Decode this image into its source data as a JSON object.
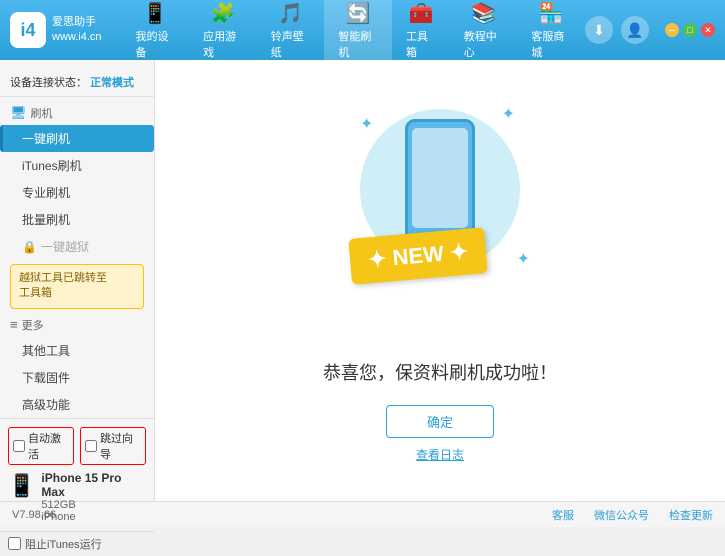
{
  "app": {
    "logo_num": "i4",
    "logo_line1": "爱思助手",
    "logo_line2": "www.i4.cn"
  },
  "nav": {
    "items": [
      {
        "label": "我的设备",
        "icon": "📱"
      },
      {
        "label": "应用游戏",
        "icon": "🧩"
      },
      {
        "label": "铃声壁纸",
        "icon": "🎵"
      },
      {
        "label": "智能刷机",
        "icon": "🔄"
      },
      {
        "label": "工具箱",
        "icon": "🧰"
      },
      {
        "label": "教程中心",
        "icon": "📚"
      },
      {
        "label": "客服商城",
        "icon": "🏪"
      }
    ]
  },
  "sidebar": {
    "status_label": "设备连接状态：",
    "status_value": "正常模式",
    "flash_section": "刷机",
    "items": [
      {
        "label": "一键刷机",
        "active": true
      },
      {
        "label": "iTunes刷机"
      },
      {
        "label": "专业刷机"
      },
      {
        "label": "批量刷机"
      }
    ],
    "disabled_item": "一键越狱",
    "warning_text": "越狱工具已跳转至\n工具箱",
    "more_section": "更多",
    "more_items": [
      {
        "label": "其他工具"
      },
      {
        "label": "下载固件"
      },
      {
        "label": "高级功能"
      }
    ],
    "auto_activate": "自动激活",
    "skip_guide": "跳过向导",
    "device_name": "iPhone 15 Pro Max",
    "device_storage": "512GB",
    "device_type": "iPhone",
    "stop_itunes": "阻止iTunes运行"
  },
  "content": {
    "new_badge": "NEW",
    "success_text": "恭喜您，保资料刷机成功啦！",
    "confirm_btn": "确定",
    "view_log": "查看日志"
  },
  "footer": {
    "version": "V7.98.66",
    "client": "客服",
    "wechat": "微信公众号",
    "check_update": "检查更新"
  }
}
